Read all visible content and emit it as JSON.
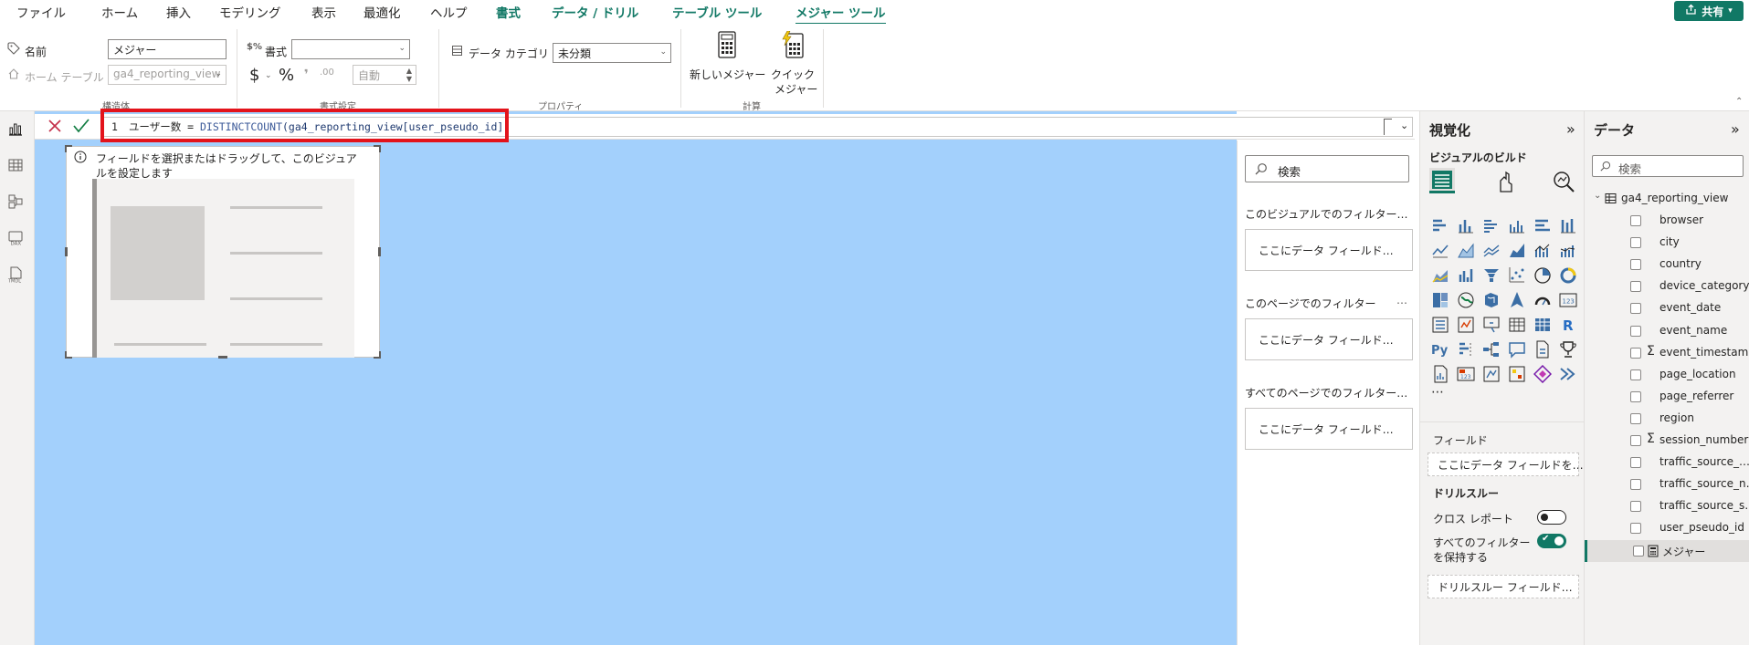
{
  "menu": {
    "items": [
      "ファイル",
      "ホーム",
      "挿入",
      "モデリング",
      "表示",
      "最適化",
      "ヘルプ"
    ],
    "context_tabs": [
      "書式",
      "データ / ドリル",
      "テーブル ツール",
      "メジャー ツール"
    ],
    "active_tab": "メジャー ツール",
    "share_label": "共有"
  },
  "ribbon": {
    "structure": {
      "name_label": "名前",
      "name_value": "メジャー",
      "home_table_label": "ホーム テーブル",
      "home_table_value": "ga4_reporting_view",
      "group_label": "構造体"
    },
    "format": {
      "format_label": "書式",
      "format_value": "",
      "currency_symbol": "$",
      "percent_symbol": "%",
      "auto_value": "自動",
      "group_label": "書式設定"
    },
    "properties": {
      "data_category_label": "データ カテゴリ",
      "data_category_value": "未分類",
      "group_label": "プロパティ"
    },
    "calculations": {
      "new_measure_label": "新しいメジャー",
      "quick_measure_label_1": "クイック",
      "quick_measure_label_2": "メジャー",
      "group_label": "計算"
    }
  },
  "formula_bar": {
    "line_number": "1",
    "expression": "ユーザー数 = DISTINCTCOUNT(ga4_reporting_view[user_pseudo_id])"
  },
  "visual_placeholder": {
    "hint_line_1": "フィールドを選択またはドラッグして、このビジュア",
    "hint_line_2": "ルを設定します"
  },
  "filters": {
    "search_placeholder": "検索",
    "sections": [
      {
        "title": "このビジュアルでのフィルター…",
        "drop_label": "ここにデータ フィールド…"
      },
      {
        "title": "このページでのフィルター",
        "drop_label": "ここにデータ フィールド…"
      },
      {
        "title": "すべてのページでのフィルター…",
        "drop_label": "ここにデータ フィールド…"
      }
    ]
  },
  "visualizations": {
    "title": "視覚化",
    "build_label": "ビジュアルのビルド",
    "fields_label": "フィールド",
    "fields_drop_label": "ここにデータ フィールドを…",
    "drillthrough_label": "ドリルスルー",
    "cross_report_label": "クロス レポート",
    "keep_filters_label_1": "すべてのフィルター",
    "keep_filters_label_2": "を保持する",
    "drillthrough_drop_label": "ドリルスルー フィールド…",
    "cross_report_on": false,
    "keep_filters_on": true
  },
  "data": {
    "title": "データ",
    "search_placeholder": "検索",
    "table_name": "ga4_reporting_view",
    "fields": [
      {
        "name": "browser",
        "type": "text"
      },
      {
        "name": "city",
        "type": "text"
      },
      {
        "name": "country",
        "type": "text"
      },
      {
        "name": "device_category",
        "type": "text"
      },
      {
        "name": "event_date",
        "type": "text"
      },
      {
        "name": "event_name",
        "type": "text"
      },
      {
        "name": "event_timestamp",
        "type": "sum"
      },
      {
        "name": "page_location",
        "type": "text"
      },
      {
        "name": "page_referrer",
        "type": "text"
      },
      {
        "name": "region",
        "type": "text"
      },
      {
        "name": "session_number",
        "type": "sum"
      },
      {
        "name": "traffic_source_…",
        "type": "text"
      },
      {
        "name": "traffic_source_n…",
        "type": "text"
      },
      {
        "name": "traffic_source_s…",
        "type": "text"
      },
      {
        "name": "user_pseudo_id",
        "type": "text"
      },
      {
        "name": "メジャー",
        "type": "measure"
      }
    ]
  },
  "colors": {
    "accent": "#117865",
    "canvas": "#a3d0fc",
    "highlight": "#e3131b",
    "formula_blue": "#3b5998"
  }
}
